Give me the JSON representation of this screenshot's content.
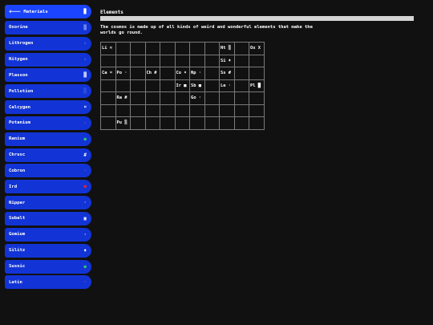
{
  "sidebar": {
    "header": {
      "label": "Materials",
      "back_glyph": "🡐",
      "status_glyph": "▉"
    },
    "items": [
      {
        "label": "Oxorine",
        "glyph": "▒",
        "color": "#c0c8ff"
      },
      {
        "label": "Lithrogen",
        "glyph": "·",
        "color": "#9aa8ff"
      },
      {
        "label": "Nitygen",
        "glyph": "·",
        "color": "#9aa8ff"
      },
      {
        "label": "Plasson",
        "glyph": "█",
        "color": "#c0c8ff"
      },
      {
        "label": "Pollution",
        "glyph": "░",
        "color": "#9aa8ff"
      },
      {
        "label": "Calcygen",
        "glyph": "¤",
        "color": "#ffffff"
      },
      {
        "label": "Potanium",
        "glyph": "·",
        "color": "#ff3b3b"
      },
      {
        "label": "Ranium",
        "glyph": "●",
        "color": "#2ed15a"
      },
      {
        "label": "Chrusc",
        "glyph": "#",
        "color": "#ffffff"
      },
      {
        "label": "Cobron",
        "glyph": "·",
        "color": "#ff3b3b"
      },
      {
        "label": "Ird",
        "glyph": "●",
        "color": "#ff2020"
      },
      {
        "label": "Nipper",
        "glyph": "·",
        "color": "#c0c8ff"
      },
      {
        "label": "Subalt",
        "glyph": "▣",
        "color": "#ffffff"
      },
      {
        "label": "Gomium",
        "glyph": "·",
        "color": "#ffffff"
      },
      {
        "label": "Silitz",
        "glyph": "♦",
        "color": "#ffffff"
      },
      {
        "label": "Susnic",
        "glyph": "●",
        "color": "#2ed15a"
      },
      {
        "label": "Latin",
        "glyph": "·",
        "color": "#ff3b3b"
      }
    ]
  },
  "main": {
    "title": "Elements",
    "progress": 0.0,
    "description": "The cosmos is made up of all kinds of weird and wonderful elements that make the worlds go round."
  },
  "grid": {
    "cols": 11,
    "rows": [
      [
        "Li ≈",
        "",
        "",
        "",
        "",
        "",
        "",
        "",
        "Nt ▒",
        "",
        "Ox X"
      ],
      [
        "",
        "",
        "",
        "",
        "",
        "",
        "",
        "",
        "Si ♦",
        "",
        ""
      ],
      [
        "Ca ¤",
        "Po ·",
        "",
        "Ch #",
        "",
        "Co ¤",
        "Np ·",
        "",
        "Ss #",
        "",
        ""
      ],
      [
        "",
        "",
        "",
        "",
        "",
        "Ir ■",
        "Sb ■",
        "",
        "Le ·",
        "",
        "Pl █"
      ],
      [
        "",
        "Ra #",
        "",
        "",
        "",
        "",
        "Go ·",
        "",
        "",
        "",
        ""
      ],
      [
        "",
        "",
        "",
        "",
        "",
        "",
        "",
        "",
        "",
        "",
        ""
      ],
      [
        "",
        "Pu ▒",
        "",
        "",
        "",
        "",
        "",
        "",
        "",
        "",
        ""
      ]
    ]
  }
}
